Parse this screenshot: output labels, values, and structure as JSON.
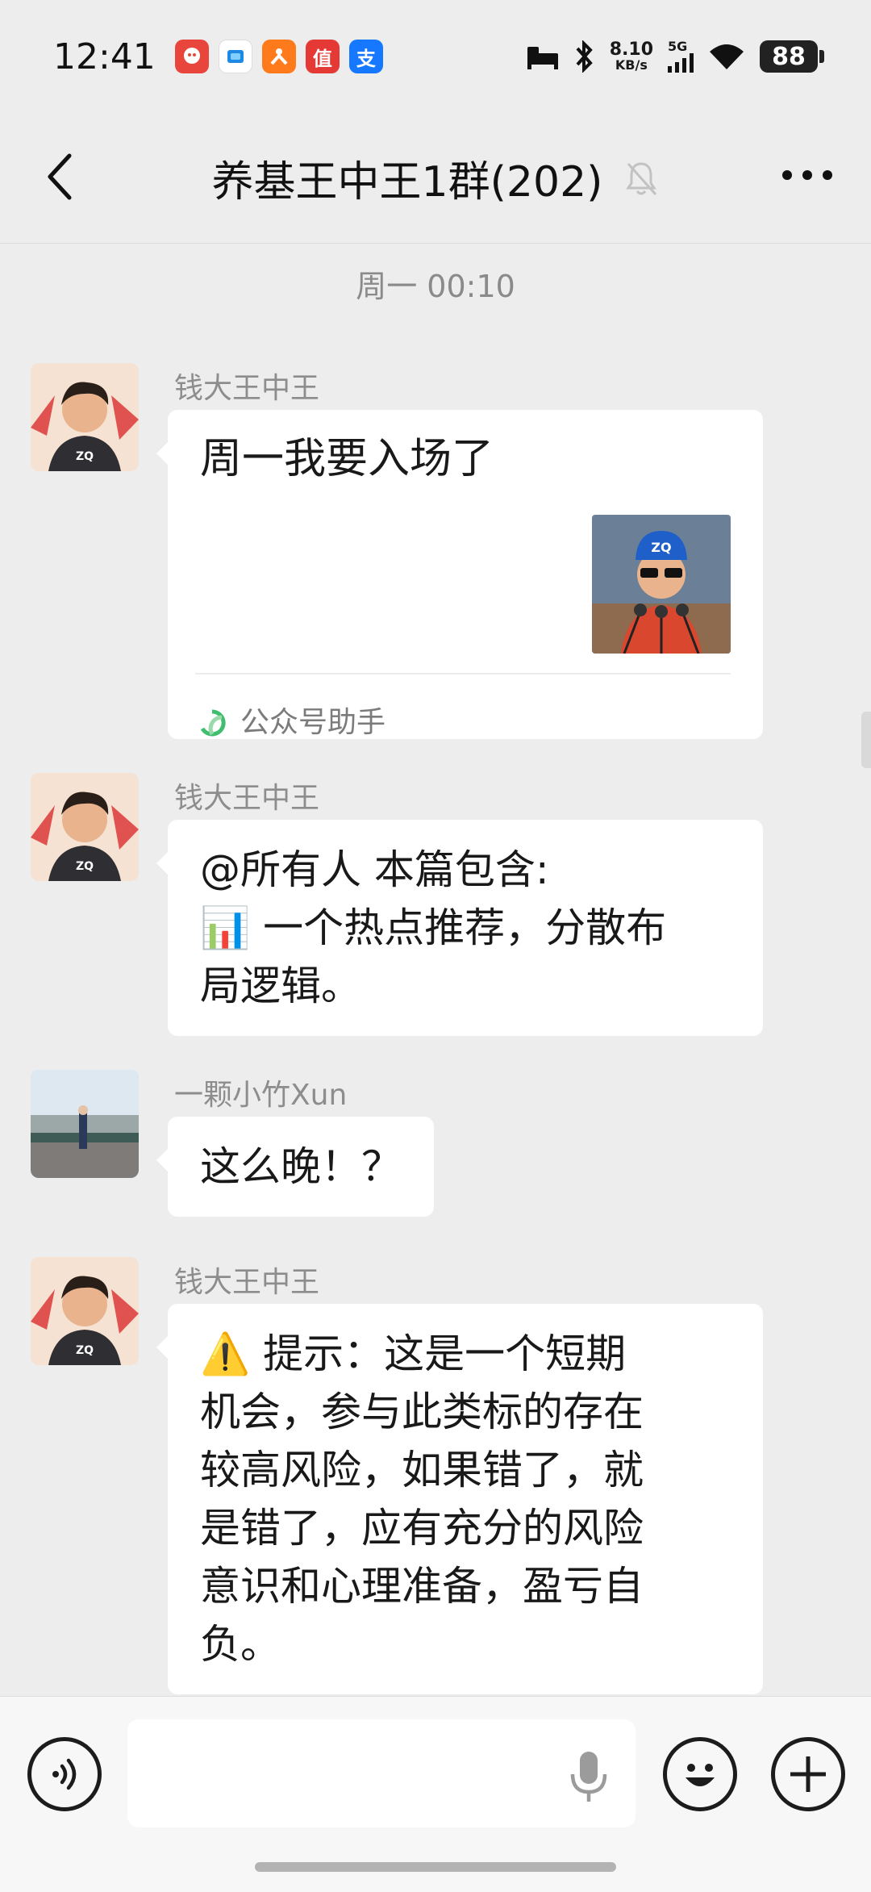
{
  "status_bar": {
    "time": "12:41",
    "apps": [
      {
        "name": "app-icon-1",
        "glyph": "",
        "color": "#E8453C"
      },
      {
        "name": "app-icon-2",
        "glyph": "",
        "color": "#1E88E5"
      },
      {
        "name": "app-icon-3",
        "glyph": "",
        "color": "#FF7A1A"
      },
      {
        "name": "app-icon-4",
        "glyph": "值",
        "color": "#E53935"
      },
      {
        "name": "app-icon-5",
        "glyph": "支",
        "color": "#1677FF"
      }
    ],
    "net_speed_value": "8.10",
    "net_speed_unit": "KB/s",
    "network_type": "5G",
    "battery": "88"
  },
  "header": {
    "title": "养基王中王1群(202)",
    "muted": true
  },
  "chat": {
    "time_divider": "周一 00:10",
    "messages": [
      {
        "sender": "钱大王中王",
        "type": "article_card",
        "title": "周一我要入场了",
        "thumb_text": "ZQ",
        "source": "公众号助手"
      },
      {
        "sender": "钱大王中王",
        "type": "text",
        "lines": [
          "@所有人  本篇包含:",
          "📊 一个热点推荐，分散布",
          "局逻辑。"
        ]
      },
      {
        "sender": "一颗小竹Xun",
        "type": "text",
        "lines": [
          "这么晚！？"
        ]
      },
      {
        "sender": "钱大王中王",
        "type": "text",
        "lines": [
          "⚠️ 提示：这是一个短期",
          "机会，参与此类标的存在",
          "较高风险，如果错了，就",
          "是错了，应有充分的风险",
          "意识和心理准备，盈亏自",
          "负。"
        ]
      }
    ]
  },
  "input": {
    "value": "",
    "placeholder": ""
  },
  "colors": {
    "background": "#EDEDED",
    "bubble": "#FFFFFF",
    "input_bar": "#F7F7F7"
  }
}
